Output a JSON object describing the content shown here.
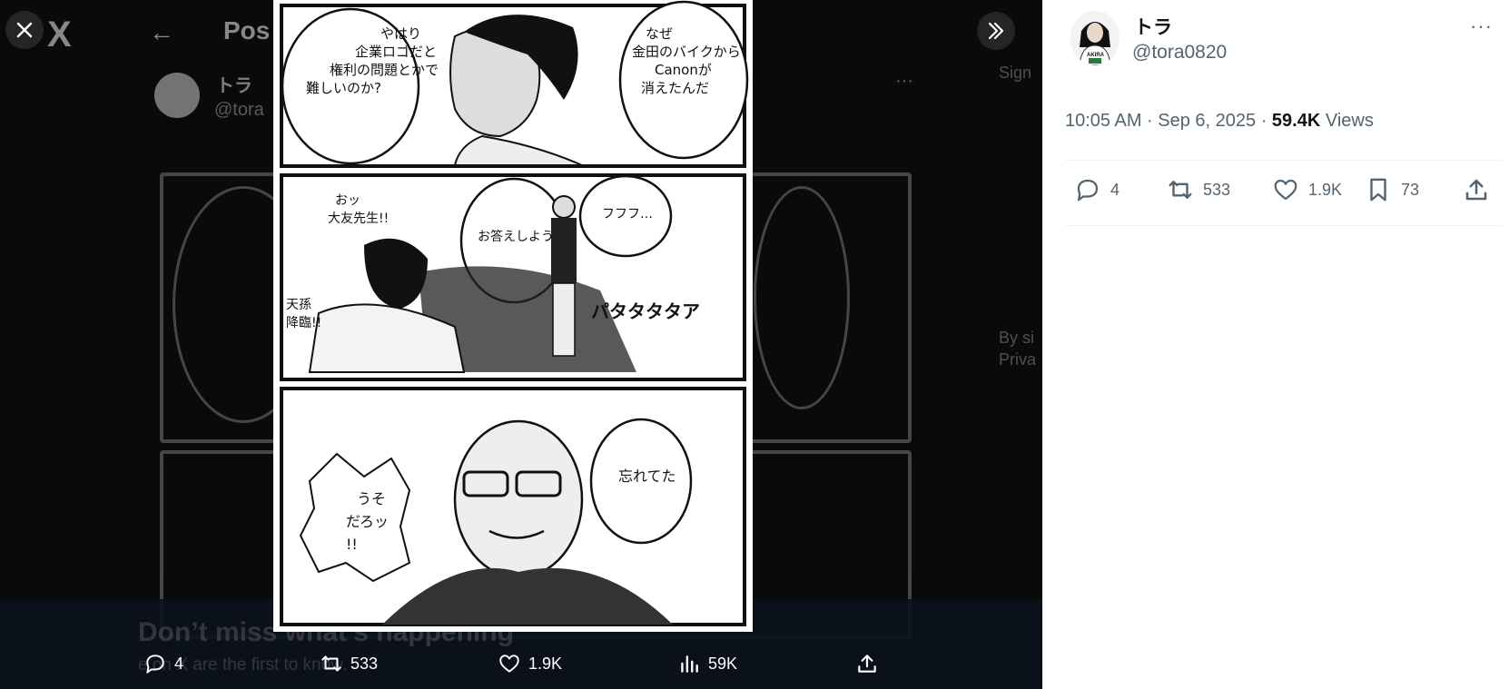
{
  "background_page": {
    "logo": "X",
    "back_glyph": "←",
    "title": "Pos",
    "author_name": "トラ",
    "author_handle": "@tora",
    "more_glyph": "···",
    "right_col_text_1": "Sign",
    "right_col_text_2": "By si",
    "right_col_text_3": "Priva",
    "banner_title": "Don’t miss what’s happening",
    "banner_subtitle": "e on X are the first to know."
  },
  "viewer": {
    "close_icon": "close-icon",
    "expand_icon": "chevron-double-right-icon"
  },
  "comic": {
    "panel1_bubble_left": [
      "やはり",
      "企業ロゴだと",
      "権利の問題とかで",
      "難しいのか?"
    ],
    "panel1_bubble_right": [
      "なぜ",
      "金田のバイクから",
      "Canonが",
      "消えたんだ"
    ],
    "panel2_shout": [
      "おッ",
      "大友先生!!"
    ],
    "panel2_caption": [
      "天孫",
      "降臨!!"
    ],
    "panel2_bubble_mid": [
      "お答えしよう"
    ],
    "panel2_bubble_right": [
      "フフフ…"
    ],
    "panel2_sfx": "パタタタタア",
    "panel3_bubble_left": [
      "うそ",
      "だろッ",
      "!!"
    ],
    "panel3_bubble_right": [
      "忘れてた"
    ]
  },
  "media_actions": {
    "reply_count": "4",
    "repost_count": "533",
    "like_count": "1.9K",
    "views_count": "59K"
  },
  "tweet": {
    "author_name": "トラ",
    "author_handle": "@tora0820",
    "avatar_text": "AKIRA",
    "more_glyph": "···",
    "time": "10:05 AM · Sep 6, 2025 · ",
    "views_value": "59.4K",
    "views_label": " Views",
    "reply_count": "4",
    "repost_count": "533",
    "like_count": "1.9K",
    "bookmark_count": "73"
  }
}
